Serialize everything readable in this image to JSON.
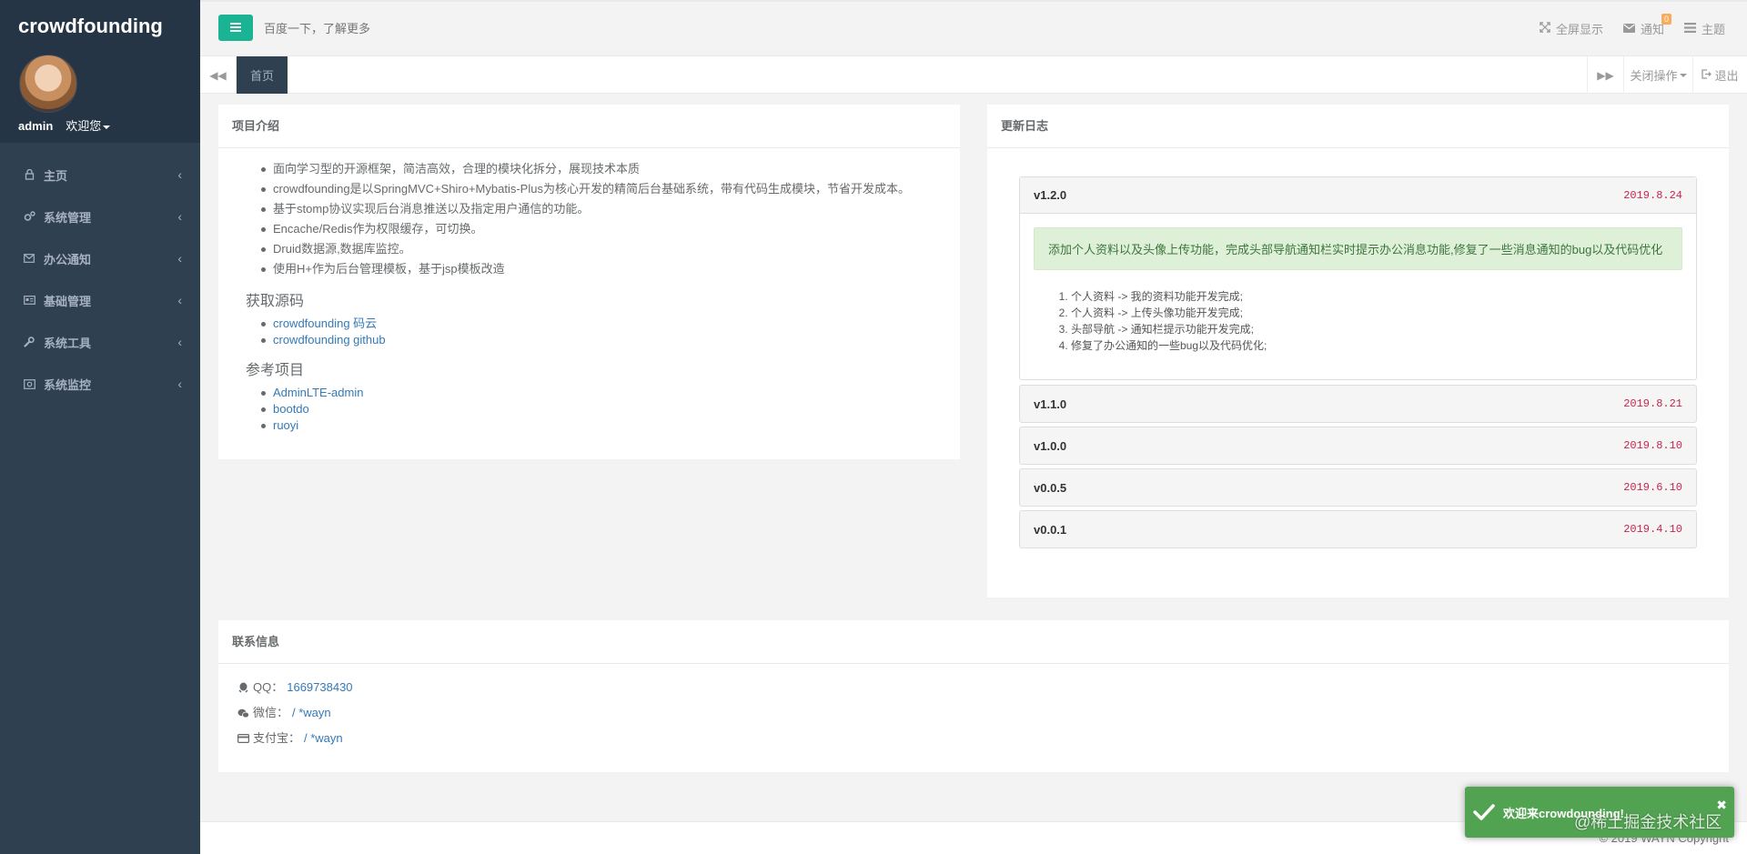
{
  "brand": {
    "name": "crowdfounding"
  },
  "profile": {
    "username": "admin",
    "greeting": "欢迎您"
  },
  "sidebar": {
    "items": [
      {
        "label": "主页",
        "icon": "home-icon"
      },
      {
        "label": "系统管理",
        "icon": "gears-icon"
      },
      {
        "label": "办公通知",
        "icon": "envelope-icon"
      },
      {
        "label": "基础管理",
        "icon": "id-card-icon"
      },
      {
        "label": "系统工具",
        "icon": "wrench-icon"
      },
      {
        "label": "系统监控",
        "icon": "monitor-icon"
      }
    ]
  },
  "header": {
    "search_placeholder": "百度一下，了解更多",
    "fullscreen_label": "全屏显示",
    "notify_label": "通知",
    "notify_count": "0",
    "theme_label": "主题"
  },
  "tabs": {
    "home_label": "首页",
    "close_ops_label": "关闭操作",
    "logout_label": "退出"
  },
  "intro": {
    "title": "项目介绍",
    "bullets": [
      "面向学习型的开源框架，简洁高效，合理的模块化拆分，展现技术本质",
      "crowdfounding是以SpringMVC+Shiro+Mybatis-Plus为核心开发的精简后台基础系统，带有代码生成模块，节省开发成本。",
      "基于stomp协议实现后台消息推送以及指定用户通信的功能。",
      "Encache/Redis作为权限缓存，可切换。",
      "Druid数据源,数据库监控。",
      "使用H+作为后台管理模板，基于jsp模板改造"
    ],
    "source_heading": "获取源码",
    "source_links": [
      "crowdfounding 码云",
      "crowdfounding github"
    ],
    "ref_heading": "参考项目",
    "ref_links": [
      "AdminLTE-admin",
      "bootdo",
      "ruoyi"
    ]
  },
  "changelog": {
    "title": "更新日志",
    "versions": [
      {
        "version": "v1.2.0",
        "date": "2019.8.24"
      },
      {
        "version": "v1.1.0",
        "date": "2019.8.21"
      },
      {
        "version": "v1.0.0",
        "date": "2019.8.10"
      },
      {
        "version": "v0.0.5",
        "date": "2019.6.10"
      },
      {
        "version": "v0.0.1",
        "date": "2019.4.10"
      }
    ],
    "open_summary": "添加个人资料以及头像上传功能，完成头部导航通知栏实时提示办公消息功能,修复了一些消息通知的bug以及代码优化",
    "open_items": [
      "个人资料 -> 我的资料功能开发完成;",
      "个人资料 -> 上传头像功能开发完成;",
      "头部导航 -> 通知栏提示功能开发完成;",
      "修复了办公通知的一些bug以及代码优化;"
    ]
  },
  "contact": {
    "title": "联系信息",
    "rows": [
      {
        "label": "QQ：",
        "value": "1669738430",
        "icon": "qq-icon"
      },
      {
        "label": "微信：",
        "value": "/ *wayn",
        "icon": "wechat-icon"
      },
      {
        "label": "支付宝：",
        "value": "/ *wayn",
        "icon": "credit-card-icon"
      }
    ]
  },
  "footer": {
    "copyright": "© 2019 WAYN Copyright"
  },
  "toast": {
    "message": "欢迎来crowdounding!"
  },
  "watermark": {
    "text": "@稀土掘金技术社区"
  },
  "colors": {
    "sidebar_bg": "#2f4050",
    "accent": "#1ab394",
    "toast_bg": "#51a351",
    "date_red": "#c7254e"
  }
}
